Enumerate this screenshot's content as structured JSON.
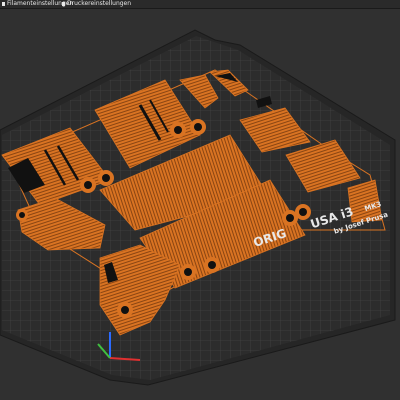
{
  "tabs": [
    {
      "label": "Filamenteinstellungen"
    },
    {
      "label": "Druckereinstellungen"
    }
  ],
  "bed_logo": {
    "line1_a": "ORIG",
    "line1_b": "USA i3",
    "line1_c": "MK3",
    "line2": "by Josef Prusa"
  },
  "colors": {
    "accent": "#e67e22",
    "bed": "#2b2b2b",
    "background": "#303030",
    "grid": "#4a4a4a"
  }
}
